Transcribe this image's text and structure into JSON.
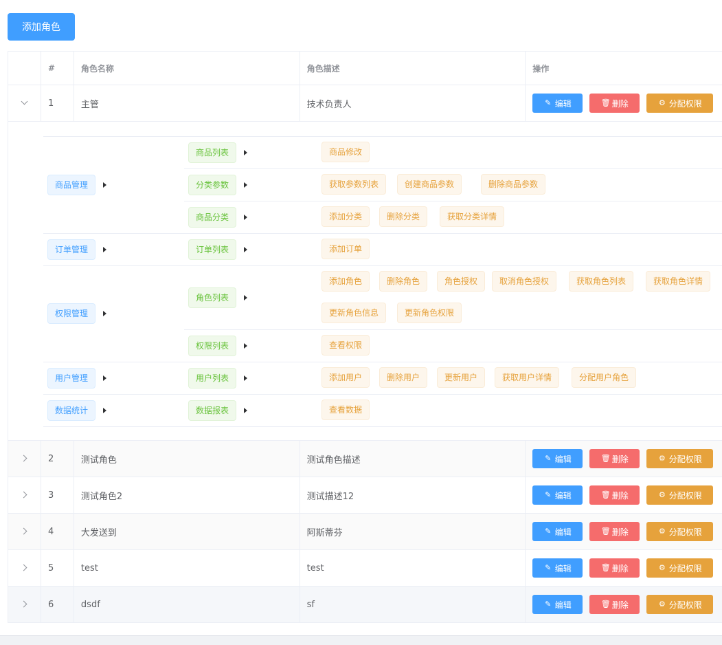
{
  "toolbar": {
    "add_role_label": "添加角色"
  },
  "table": {
    "headers": [
      "#",
      "角色名称",
      "角色描述",
      "操作"
    ],
    "rows": [
      {
        "index": "1",
        "name": "主管",
        "desc": "技术负责人",
        "expanded": true
      },
      {
        "index": "2",
        "name": "测试角色",
        "desc": "测试角色描述"
      },
      {
        "index": "3",
        "name": "测试角色2",
        "desc": "测试描述12"
      },
      {
        "index": "4",
        "name": "大发送到",
        "desc": "阿斯蒂芬"
      },
      {
        "index": "5",
        "name": "test",
        "desc": "test"
      },
      {
        "index": "6",
        "name": "dsdf",
        "desc": "sf"
      }
    ]
  },
  "actions": {
    "edit": "编辑",
    "delete": "删除",
    "assign": "分配权限"
  },
  "icons": {
    "edit": "pencil-icon",
    "delete": "trash-icon",
    "assign": "gear-icon",
    "expand": "chevron-right-icon",
    "caret": "caret-right-icon"
  },
  "rights": [
    {
      "name": "商品管理",
      "children": [
        {
          "name": "商品列表",
          "children": [
            "商品修改"
          ]
        },
        {
          "name": "分类参数",
          "children": [
            "获取参数列表",
            "创建商品参数",
            "删除商品参数"
          ]
        },
        {
          "name": "商品分类",
          "children": [
            "添加分类",
            "删除分类",
            "获取分类详情"
          ]
        }
      ]
    },
    {
      "name": "订单管理",
      "children": [
        {
          "name": "订单列表",
          "children": [
            "添加订单"
          ]
        }
      ]
    },
    {
      "name": "权限管理",
      "children": [
        {
          "name": "角色列表",
          "children": [
            "添加角色",
            "删除角色",
            "角色授权",
            "取消角色授权",
            "获取角色列表",
            "获取角色详情",
            "更新角色信息",
            "更新角色权限"
          ]
        },
        {
          "name": "权限列表",
          "children": [
            "查看权限"
          ]
        }
      ]
    },
    {
      "name": "用户管理",
      "children": [
        {
          "name": "用户列表",
          "children": [
            "添加用户",
            "删除用户",
            "更新用户",
            "获取用户详情",
            "分配用户角色"
          ]
        }
      ]
    },
    {
      "name": "数据统计",
      "children": [
        {
          "name": "数据报表",
          "children": [
            "查看数据"
          ]
        }
      ]
    }
  ],
  "colors": {
    "primary": "#409eff",
    "danger": "#f56c6c",
    "warning": "#e6a23c",
    "success": "#67c23a"
  }
}
